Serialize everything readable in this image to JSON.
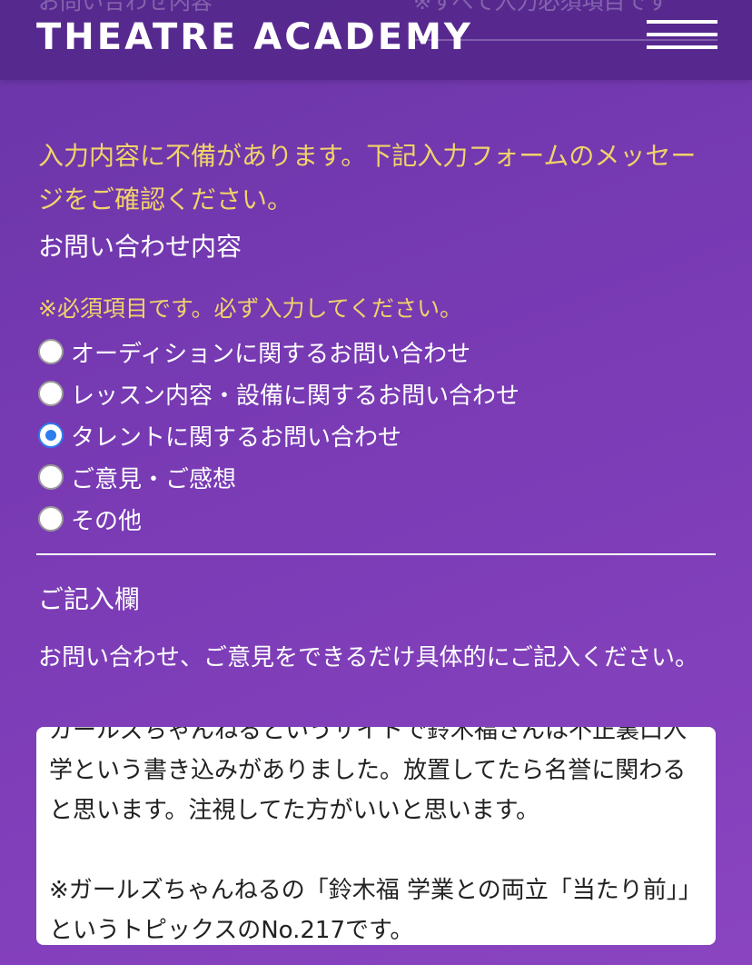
{
  "header": {
    "logo": "THEATRE ACADEMY",
    "behind_left_text": "お問い合わせ内容",
    "behind_right_text": "※すべて入力必須項目です"
  },
  "form": {
    "error_message": "入力内容に不備があります。下記入力フォームのメッセージをご確認ください。",
    "inquiry_title": "お問い合わせ内容",
    "required_note": "※必須項目です。必ず入力してください。",
    "options": [
      {
        "label": "オーディションに関するお問い合わせ",
        "checked": false
      },
      {
        "label": "レッスン内容・設備に関するお問い合わせ",
        "checked": false
      },
      {
        "label": "タレントに関するお問い合わせ",
        "checked": true
      },
      {
        "label": "ご意見・ご感想",
        "checked": false
      },
      {
        "label": "その他",
        "checked": false
      }
    ],
    "comment_title": "ご記入欄",
    "comment_description": "お問い合わせ、ご意見をできるだけ具体的にご記入ください。",
    "comment_value": "ガールズちゃんねるというサイトで鈴木福さんは不正裏口入学という書き込みがありました。放置してたら名誉に関わると思います。注視してた方がいいと思います。\n\n※ガールズちゃんねるの「鈴木福 学業との両立「当たり前」」というトピックスのNo.217です。"
  },
  "colors": {
    "background": "#7a3bb5",
    "header": "#55288c",
    "warning_text": "#f1d36a",
    "radio_selected": "#2f7bf0"
  }
}
